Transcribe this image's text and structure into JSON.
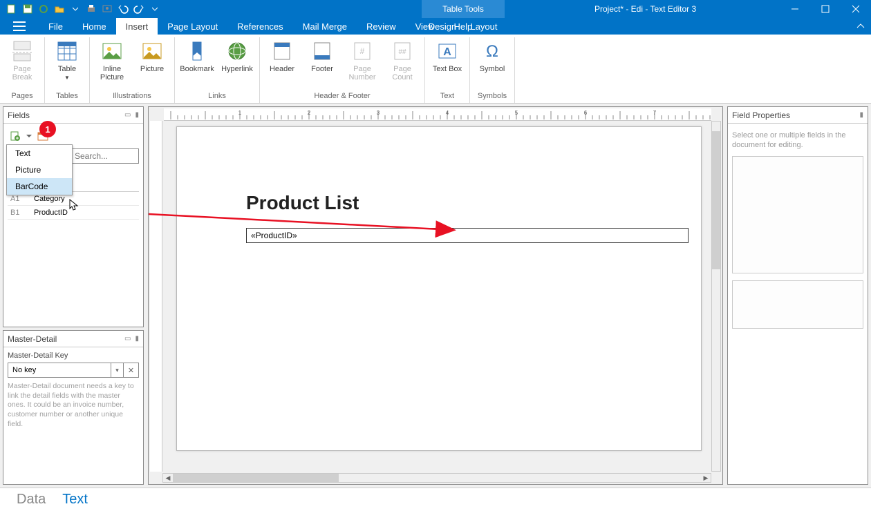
{
  "titlebar": {
    "context_title": "Table Tools",
    "app_title": "Project* - Edi - Text Editor 3"
  },
  "tabs": {
    "file": "File",
    "items": [
      "Home",
      "Insert",
      "Page Layout",
      "References",
      "Mail Merge",
      "Review",
      "View",
      "Help"
    ],
    "active": "Insert",
    "context_items": [
      "Design",
      "Layout"
    ]
  },
  "ribbon": {
    "groups": [
      {
        "label": "Pages",
        "buttons": [
          {
            "name": "page-break",
            "label": "Page Break",
            "disabled": true,
            "icon": "page-break"
          }
        ]
      },
      {
        "label": "Tables",
        "buttons": [
          {
            "name": "table",
            "label": "Table",
            "drop": true,
            "icon": "table"
          }
        ]
      },
      {
        "label": "Illustrations",
        "buttons": [
          {
            "name": "inline-picture",
            "label": "Inline Picture",
            "icon": "picture"
          },
          {
            "name": "picture",
            "label": "Picture",
            "icon": "picture2"
          }
        ]
      },
      {
        "label": "Links",
        "buttons": [
          {
            "name": "bookmark",
            "label": "Bookmark",
            "icon": "bookmark"
          },
          {
            "name": "hyperlink",
            "label": "Hyperlink",
            "icon": "globe"
          }
        ]
      },
      {
        "label": "Header & Footer",
        "buttons": [
          {
            "name": "header",
            "label": "Header",
            "icon": "header"
          },
          {
            "name": "footer",
            "label": "Footer",
            "icon": "footer"
          },
          {
            "name": "page-number",
            "label": "Page Number",
            "disabled": true,
            "icon": "pagenum"
          },
          {
            "name": "page-count",
            "label": "Page Count",
            "disabled": true,
            "icon": "pagecount"
          }
        ]
      },
      {
        "label": "Text",
        "buttons": [
          {
            "name": "text-box",
            "label": "Text Box",
            "icon": "textbox"
          }
        ]
      },
      {
        "label": "Symbols",
        "buttons": [
          {
            "name": "symbol",
            "label": "Symbol",
            "icon": "omega"
          }
        ]
      }
    ]
  },
  "fields_panel": {
    "title": "Fields",
    "search_placeholder": "Search...",
    "dropdown": [
      {
        "label": "Text",
        "hover": false
      },
      {
        "label": "Picture",
        "hover": false
      },
      {
        "label": "BarCode",
        "hover": true
      }
    ],
    "rows": [
      {
        "idx": "A1",
        "name": "Category"
      },
      {
        "idx": "B1",
        "name": "ProductID"
      }
    ],
    "badge": "1"
  },
  "master_detail": {
    "title": "Master-Detail",
    "key_label": "Master-Detail Key",
    "key_value": "No key",
    "help": "Master-Detail document needs a key to link the detail fields with the master ones. It could be an invoice number, customer number or another unique field."
  },
  "document": {
    "heading": "Product List",
    "cell": "«ProductID»"
  },
  "right_panel": {
    "title": "Field Properties",
    "hint": "Select one or multiple fields in the document for editing."
  },
  "status_tabs": {
    "data": "Data",
    "text": "Text",
    "active": "Text"
  }
}
